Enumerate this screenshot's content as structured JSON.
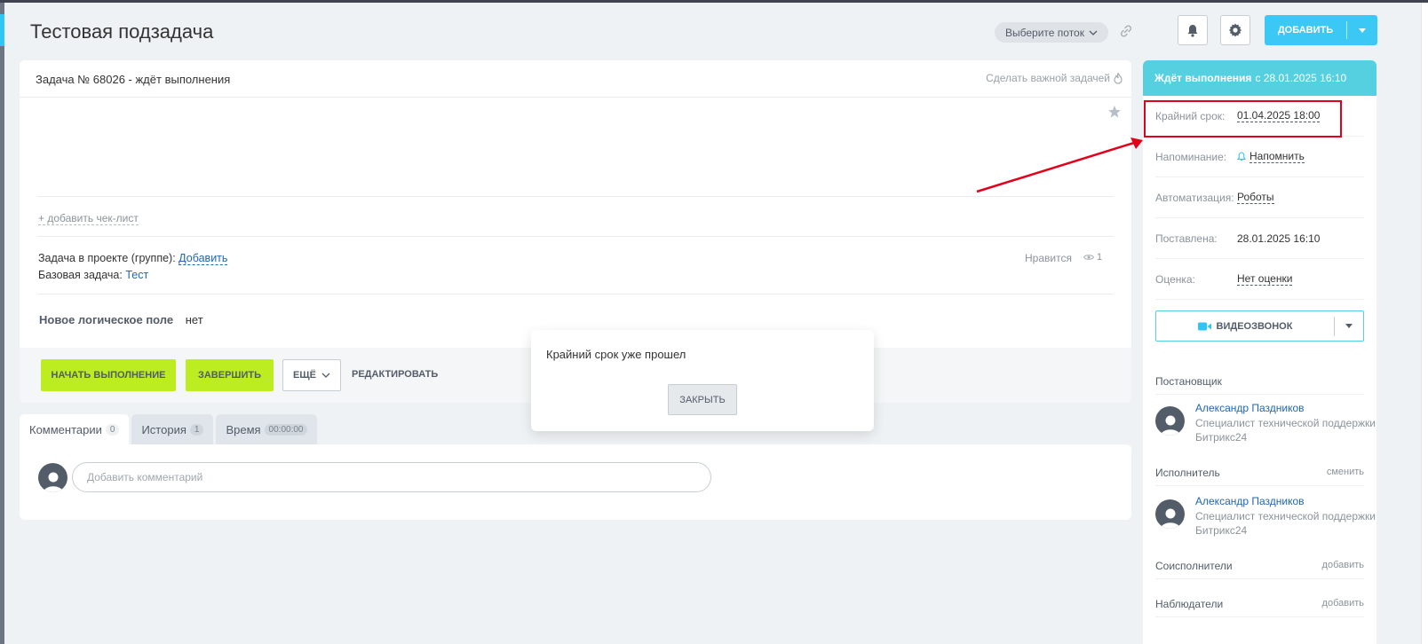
{
  "header": {
    "title": "Тестовая подзадача",
    "flow_label": "Выберите поток",
    "add_label": "ДОБАВИТЬ"
  },
  "task": {
    "number_text": "Задача № 68026 - ждёт выполнения",
    "make_important": "Сделать важной задачей",
    "add_checklist": "+ добавить чек-лист",
    "project_label": "Задача в проекте (группе):",
    "project_link": "Добавить",
    "base_label": "Базовая задача:",
    "base_link": "Тест",
    "like_label": "Нравится",
    "views_count": "1",
    "logic_field_label": "Новое логическое поле",
    "logic_field_value": "нет"
  },
  "buttons": {
    "start": "НАЧАТЬ ВЫПОЛНЕНИЕ",
    "finish": "ЗАВЕРШИТЬ",
    "more": "ЕЩЁ",
    "edit": "РЕДАКТИРОВАТЬ"
  },
  "tabs": [
    {
      "label": "Комментарии",
      "count": "0"
    },
    {
      "label": "История",
      "count": "1"
    },
    {
      "label": "Время",
      "count": "00:00:00"
    }
  ],
  "comment": {
    "placeholder": "Добавить комментарий"
  },
  "modal": {
    "message": "Крайний срок уже прошел",
    "close_label": "ЗАКРЫТЬ"
  },
  "sidebar": {
    "status_bold": "Ждёт выполнения",
    "status_rest": "с 28.01.2025 16:10",
    "rows": [
      {
        "key": "Крайний срок:",
        "value": "01.04.2025 18:00"
      },
      {
        "key": "Напоминание:",
        "value": "Напомнить"
      },
      {
        "key": "Автоматизация:",
        "value": "Роботы"
      },
      {
        "key": "Поставлена:",
        "value": "28.01.2025 16:10"
      },
      {
        "key": "Оценка:",
        "value": "Нет оценки"
      }
    ],
    "video_label": "ВИДЕОЗВОНОК",
    "creator_title": "Постановщик",
    "assignee_title": "Исполнитель",
    "assignee_action": "сменить",
    "coexec_title": "Соисполнители",
    "coexec_action": "добавить",
    "observers_title": "Наблюдатели",
    "observers_action": "добавить",
    "creator": {
      "name": "Александр Паздников",
      "position_1": "Специалист технической поддержки",
      "position_2": "Битрикс24"
    },
    "assignee": {
      "name": "Александр Паздников",
      "position_1": "Специалист технической поддержки",
      "position_2": "Битрикс24"
    }
  },
  "colors": {
    "accent": "#3bc8f5",
    "status": "#55d0e0",
    "primary_button": "#bbed21",
    "highlight": "#e2001a"
  }
}
